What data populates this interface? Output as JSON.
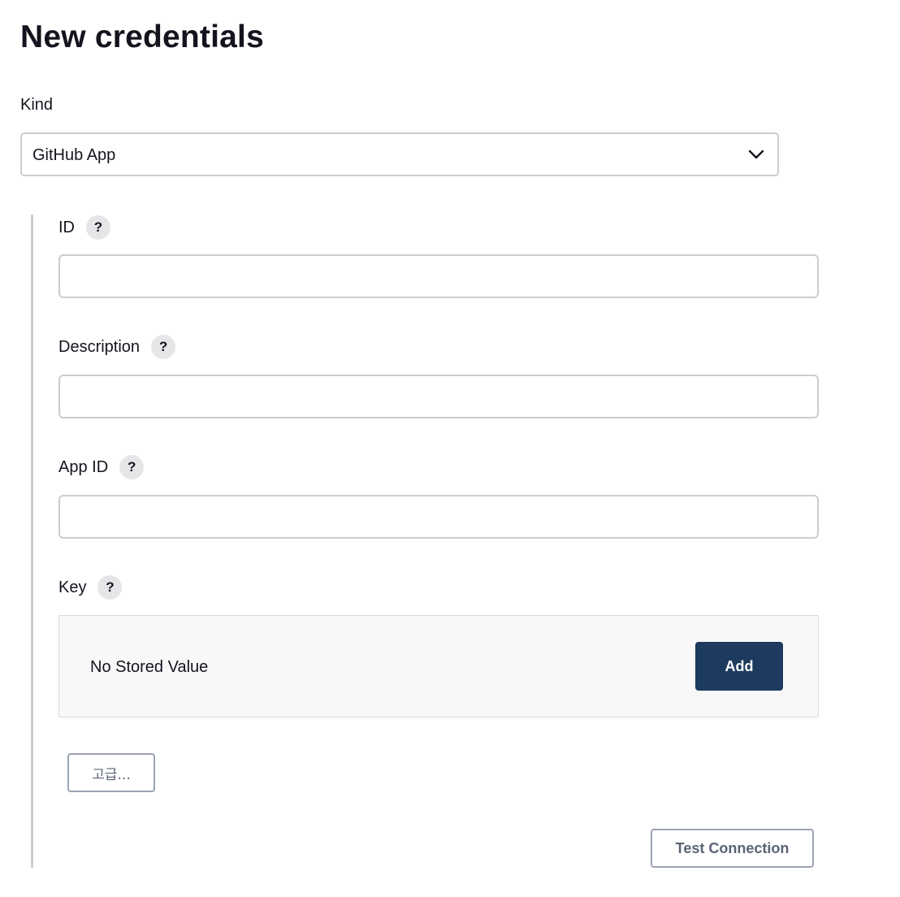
{
  "page": {
    "title": "New credentials"
  },
  "kind": {
    "label": "Kind",
    "selected": "GitHub App",
    "icon": "chevron-down-icon"
  },
  "fields": {
    "id": {
      "label": "ID",
      "value": "",
      "help": "?"
    },
    "description": {
      "label": "Description",
      "value": "",
      "help": "?"
    },
    "app_id": {
      "label": "App ID",
      "value": "",
      "help": "?"
    },
    "key": {
      "label": "Key",
      "help": "?",
      "status": "No Stored Value",
      "add_label": "Add"
    }
  },
  "buttons": {
    "advanced": "고급...",
    "test_connection": "Test Connection"
  },
  "colors": {
    "primary_button": "#1c3b5e",
    "border": "#c8cfd1",
    "help_bg": "#e6e6e8",
    "secondary_text": "#5b6475"
  }
}
